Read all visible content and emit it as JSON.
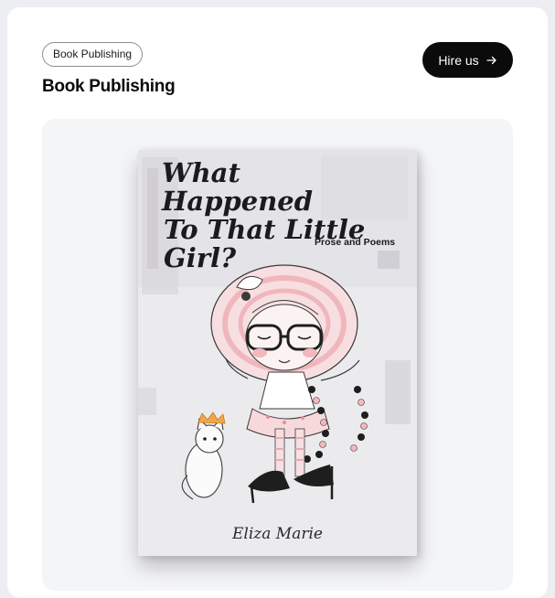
{
  "header": {
    "tag_label": "Book Publishing",
    "title": "Book Publishing",
    "hire_label": "Hire us"
  },
  "book": {
    "title_line1": "What Happened",
    "title_line2": "To That Little Girl?",
    "subtitle": "Prose and Poems",
    "author": "Eliza Marie"
  },
  "icons": {
    "hire_arrow": "arrow-right-icon"
  },
  "colors": {
    "page_bg": "#eceef1",
    "card_bg": "#ffffff",
    "panel_bg": "#f4f5f7",
    "button_bg": "#0b0b0b",
    "button_text": "#ffffff",
    "accent_pink": "#f2b8bb"
  }
}
